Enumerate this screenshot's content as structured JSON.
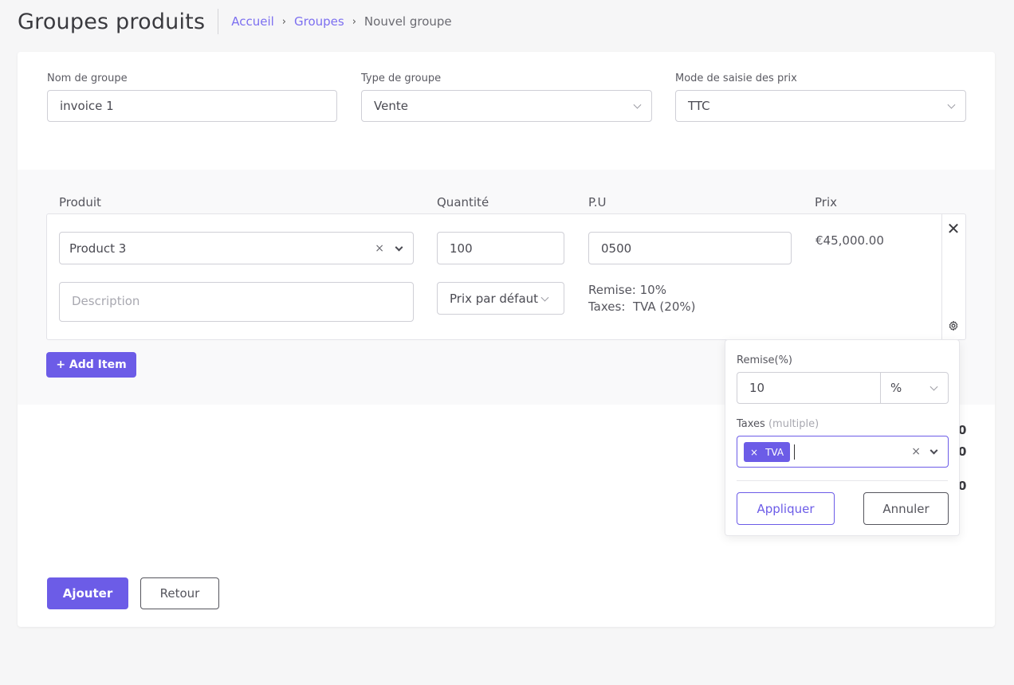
{
  "header": {
    "title": "Groupes produits",
    "breadcrumb": {
      "home": "Accueil",
      "groups": "Groupes",
      "current": "Nouvel groupe"
    }
  },
  "form": {
    "group_name": {
      "label": "Nom de groupe",
      "value": "invoice 1"
    },
    "group_type": {
      "label": "Type de groupe",
      "value": "Vente"
    },
    "price_mode": {
      "label": "Mode de saisie des prix",
      "value": "TTC"
    }
  },
  "items": {
    "columns": {
      "product": "Produit",
      "quantity": "Quantité",
      "unit_price": "P.U",
      "price": "Prix"
    },
    "row": {
      "product": "Product 3",
      "clear": "×",
      "quantity": "100",
      "unit_price": "0500",
      "price": "€45,000.00",
      "description_placeholder": "Description",
      "price_type": "Prix par défaut",
      "discount": "Remise: 10%",
      "taxes_label": "Taxes:",
      "taxes_value": "TVA (20%)",
      "remove": "✕"
    },
    "add_item": "+ Add Item"
  },
  "totals": {
    "line1": "0",
    "line2": "0",
    "line3": "0"
  },
  "popover": {
    "discount_label": "Remise(%)",
    "discount_value": "10",
    "discount_unit": "%",
    "taxes_label": "Taxes",
    "taxes_hint": "(multiple)",
    "tag_remove": "×",
    "tag_label": "TVA",
    "clear": "×",
    "apply": "Appliquer",
    "cancel": "Annuler"
  },
  "actions": {
    "submit": "Ajouter",
    "back": "Retour"
  },
  "colors": {
    "accent": "#6c5ce7",
    "link": "#7c6ff0"
  }
}
